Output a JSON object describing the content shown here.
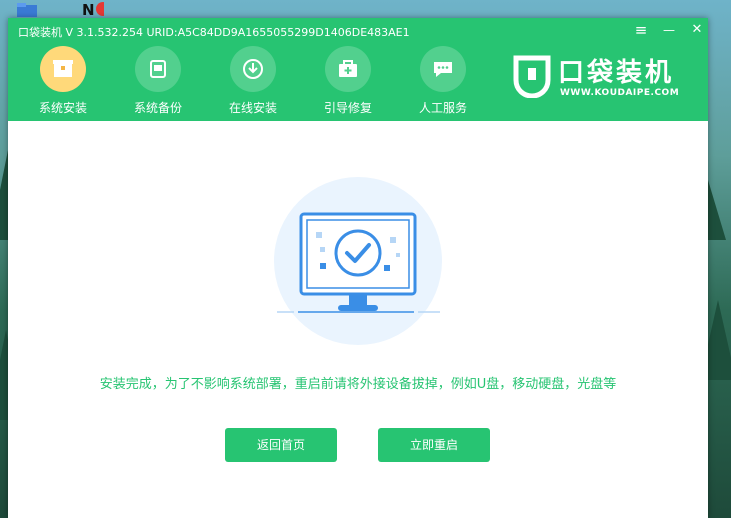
{
  "window": {
    "title": "口袋装机 V 3.1.532.254 URID:A5C84DD9A1655055299D1406DE483AE1",
    "menu_icon": "≡",
    "minimize_icon": "—",
    "close_icon": "✕"
  },
  "nav": {
    "items": [
      {
        "label": "系统安装",
        "icon": "system-install-icon",
        "active": true
      },
      {
        "label": "系统备份",
        "icon": "system-backup-icon",
        "active": false
      },
      {
        "label": "在线安装",
        "icon": "online-install-icon",
        "active": false
      },
      {
        "label": "引导修复",
        "icon": "boot-repair-icon",
        "active": false
      },
      {
        "label": "人工服务",
        "icon": "chat-service-icon",
        "active": false
      }
    ]
  },
  "logo": {
    "brand": "口袋装机",
    "url": "WWW.KOUDAIPE.COM"
  },
  "main": {
    "message": "安装完成，为了不影响系统部署，重启前请将外接设备拔掉，例如U盘，移动硬盘，光盘等",
    "back_button": "返回首页",
    "restart_button": "立即重启"
  },
  "colors": {
    "accent": "#27c472",
    "active_nav": "#ffd97a",
    "illustration_bg": "#eaf4fe",
    "illustration_stroke": "#3a8ee6"
  }
}
